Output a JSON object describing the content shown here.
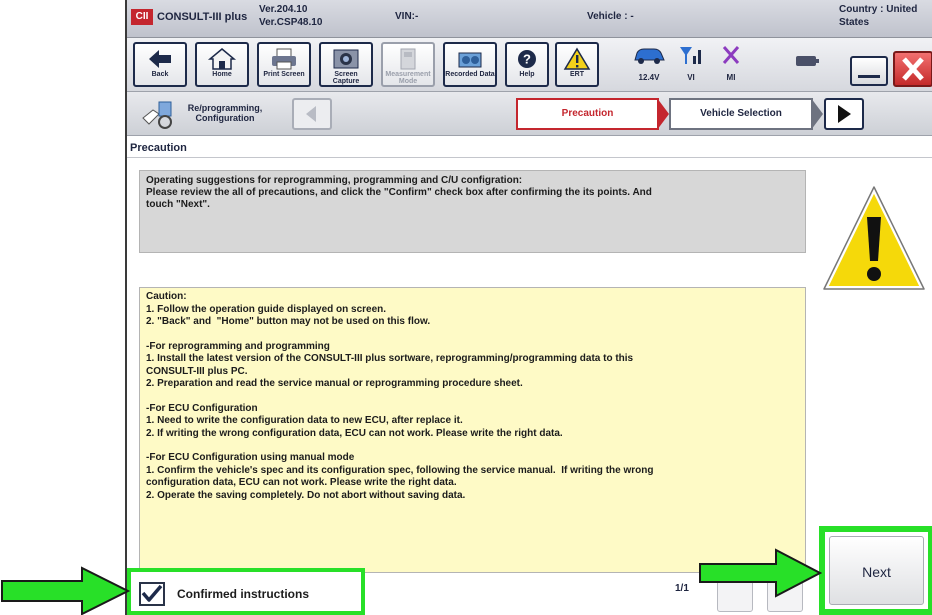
{
  "titlebar": {
    "logo": "CII",
    "app_name": "CONSULT-III plus",
    "version_line1": "Ver.204.10",
    "version_line2": "Ver.CSP48.10",
    "vin": "VIN:-",
    "vehicle": "Vehicle : -",
    "country_line1": "Country : United",
    "country_line2": "States"
  },
  "toolbar": {
    "back": "Back",
    "home": "Home",
    "print_screen": "Print Screen",
    "screen_capture": "Screen Capture",
    "measurement_mode": "Measurement Mode",
    "recorded_data": "Recorded Data",
    "help": "Help",
    "ert": "ERT",
    "battery_voltage": "12.4V",
    "vi": "VI",
    "mi": "MI"
  },
  "nav": {
    "mode_label": "Re/programming, Configuration",
    "steps": [
      "Precaution",
      "Vehicle Selection"
    ]
  },
  "content": {
    "section_title": "Precaution",
    "intro": "Operating suggestions for reprogramming, programming and C/U configration:\nPlease review the all of precautions, and click the \"Confirm\" check box after confirming the its points. And\ntouch \"Next\".",
    "caution_paragraphs": [
      "Caution:\n1. Follow the operation guide displayed on screen.\n2. \"Back\" and  \"Home\" button may not be used on this flow.",
      "-For reprogramming and programming\n1. Install the latest version of the CONSULT-III plus sortware, reprogramming/programming data to this\nCONSULT-III plus PC.\n2. Preparation and read the service manual or reprogramming procedure sheet.",
      "-For ECU Configuration\n1. Need to write the configuration data to new ECU, after replace it.\n2. If writing the wrong configuration data, ECU can not work. Please write the right data.",
      "-For ECU Configuration using manual mode\n1. Confirm the vehicle's spec and its configuration spec, following the service manual.  If writing the wrong\nconfiguration data, ECU can not work. Please write the right data.\n2. Operate the saving completely. Do not abort without saving data."
    ]
  },
  "footer": {
    "confirm_label": "Confirmed instructions",
    "confirm_checked": true,
    "page_indicator": "1/1",
    "next_label": "Next"
  },
  "colors": {
    "highlight_green": "#28e028",
    "accent_red": "#c4262e",
    "caution_bg": "#fefac6",
    "intro_bg": "#d7d7d7"
  },
  "icons": [
    "back-arrow-icon",
    "home-icon",
    "printer-icon",
    "camera-icon",
    "meter-icon",
    "recorded-data-icon",
    "help-icon",
    "ert-warning-icon",
    "car-icon",
    "signal-icon",
    "mi-x-icon",
    "battery-icon",
    "warning-icon",
    "checkmark-icon"
  ]
}
